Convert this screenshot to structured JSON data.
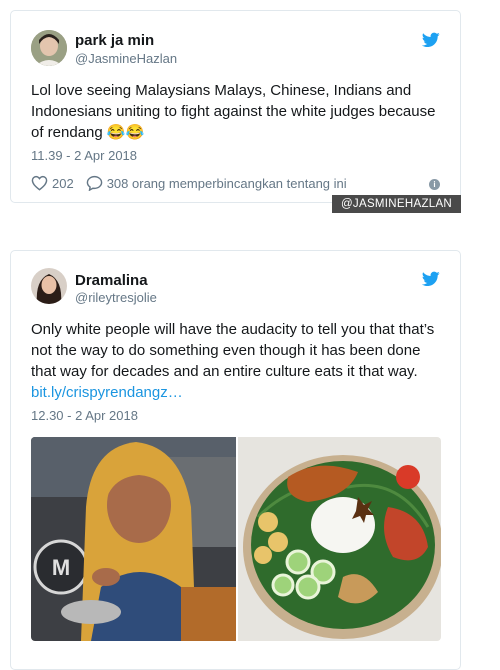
{
  "tweet1": {
    "name": "park ja min",
    "handle": "@JasmineHazlan",
    "text": "Lol love seeing Malaysians Malays, Chinese, Indians and Indonesians uniting to fight against the white judges because of rendang 😂😂",
    "timestamp": "11.39 - 2 Apr 2018",
    "likes": "202",
    "replies_text": "308 orang memperbincangkan tentang ini"
  },
  "watermark": "@JASMINEHAZLAN",
  "tweet2": {
    "name": "Dramalina",
    "handle": "@rileytresjolie",
    "text": "Only white people will have the audacity to tell you that that’s not the way to do something even though it has been done that way for decades and an entire culture eats it that way. ",
    "link": "bit.ly/crispyrendangz…",
    "timestamp": "12.30 - 2 Apr 2018"
  },
  "colors": {
    "twitter_blue": "#1da1f2",
    "link_blue": "#1b95e0",
    "muted": "#657786",
    "border": "#e1e8ed"
  },
  "icons": [
    "twitter-bird-icon",
    "heart-icon",
    "reply-bubble-icon",
    "info-icon"
  ]
}
